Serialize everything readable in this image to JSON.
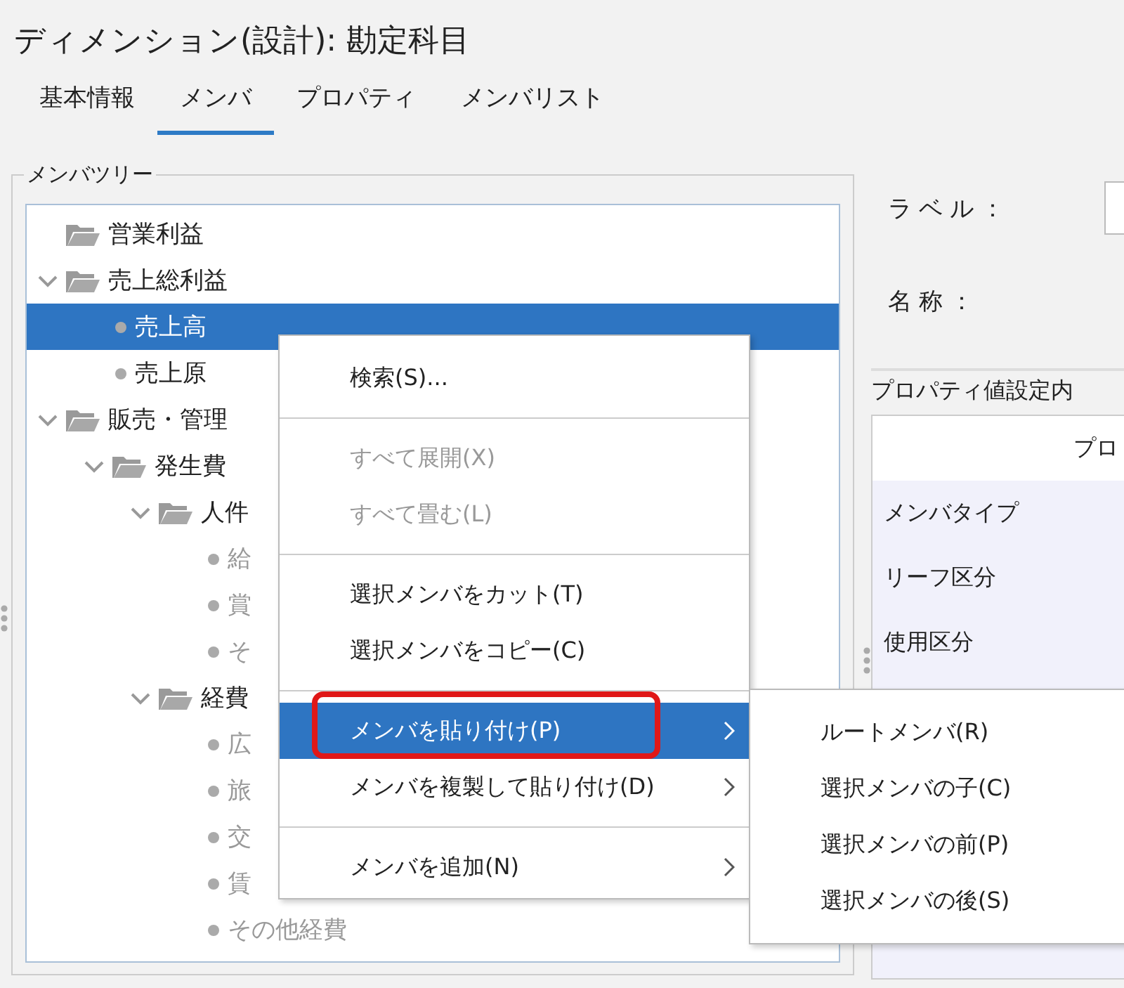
{
  "window": {
    "title": "ディメンション(設計): 勘定科目"
  },
  "tabs": [
    {
      "label": "基本情報",
      "selected": false
    },
    {
      "label": "メンバ",
      "selected": true
    },
    {
      "label": "プロパティ",
      "selected": false
    },
    {
      "label": "メンバリスト",
      "selected": false
    }
  ],
  "member_tree": {
    "legend": "メンバツリー",
    "items": [
      {
        "label": "営業利益",
        "kind": "folder",
        "selected": false
      },
      {
        "label": "売上総利益",
        "kind": "folder",
        "expanded": true,
        "selected": false,
        "children": [
          {
            "label": "売上高",
            "kind": "leaf",
            "selected": true,
            "disabled": false
          },
          {
            "label": "売上原",
            "kind": "leaf",
            "selected": false,
            "disabled": false
          }
        ]
      },
      {
        "label": "販売・管理",
        "kind": "folder",
        "expanded": true,
        "selected": false,
        "children": [
          {
            "label": "発生費",
            "kind": "folder",
            "expanded": true,
            "selected": false,
            "children": [
              {
                "label": "人件",
                "kind": "folder",
                "expanded": true,
                "selected": false,
                "children": [
                  {
                    "label": "給",
                    "kind": "leaf",
                    "selected": false,
                    "disabled": true
                  },
                  {
                    "label": "賞",
                    "kind": "leaf",
                    "selected": false,
                    "disabled": true
                  },
                  {
                    "label": "そ",
                    "kind": "leaf",
                    "selected": false,
                    "disabled": true
                  }
                ]
              },
              {
                "label": "経費",
                "kind": "folder",
                "expanded": true,
                "selected": false,
                "children": [
                  {
                    "label": "広",
                    "kind": "leaf",
                    "selected": false,
                    "disabled": true
                  },
                  {
                    "label": "旅",
                    "kind": "leaf",
                    "selected": false,
                    "disabled": true
                  },
                  {
                    "label": "交",
                    "kind": "leaf",
                    "selected": false,
                    "disabled": true
                  },
                  {
                    "label": "賃",
                    "kind": "leaf",
                    "selected": false,
                    "disabled": true
                  },
                  {
                    "label": "その他経費",
                    "kind": "leaf",
                    "selected": false,
                    "disabled": true
                  }
                ]
              }
            ]
          }
        ]
      }
    ]
  },
  "details": {
    "label_field": "ラベル：",
    "name_field": "名称："
  },
  "properties": {
    "title": "プロパティ値設定内",
    "header": "プロ",
    "rows": [
      "メンバタイプ",
      "リーフ区分",
      "使用区分"
    ]
  },
  "context_menu": [
    {
      "kind": "item",
      "label": "検索(S)...",
      "disabled": false,
      "selected": false,
      "submenu": false
    },
    {
      "kind": "separator"
    },
    {
      "kind": "item",
      "label": "すべて展開(X)",
      "disabled": true,
      "selected": false,
      "submenu": false
    },
    {
      "kind": "item",
      "label": "すべて畳む(L)",
      "disabled": true,
      "selected": false,
      "submenu": false
    },
    {
      "kind": "separator"
    },
    {
      "kind": "item",
      "label": "選択メンバをカット(T)",
      "disabled": false,
      "selected": false,
      "submenu": false
    },
    {
      "kind": "item",
      "label": "選択メンバをコピー(C)",
      "disabled": false,
      "selected": false,
      "submenu": false
    },
    {
      "kind": "separator"
    },
    {
      "kind": "item",
      "label": "メンバを貼り付け(P)",
      "disabled": false,
      "selected": true,
      "submenu": true,
      "emphasized": true
    },
    {
      "kind": "item",
      "label": "メンバを複製して貼り付け(D)",
      "disabled": false,
      "selected": false,
      "submenu": true
    },
    {
      "kind": "separator"
    },
    {
      "kind": "item",
      "label": "メンバを追加(N)",
      "disabled": false,
      "selected": false,
      "submenu": true
    }
  ],
  "submenu": [
    "ルートメンバ(R)",
    "選択メンバの子(C)",
    "選択メンバの前(P)",
    "選択メンバの後(S)"
  ]
}
